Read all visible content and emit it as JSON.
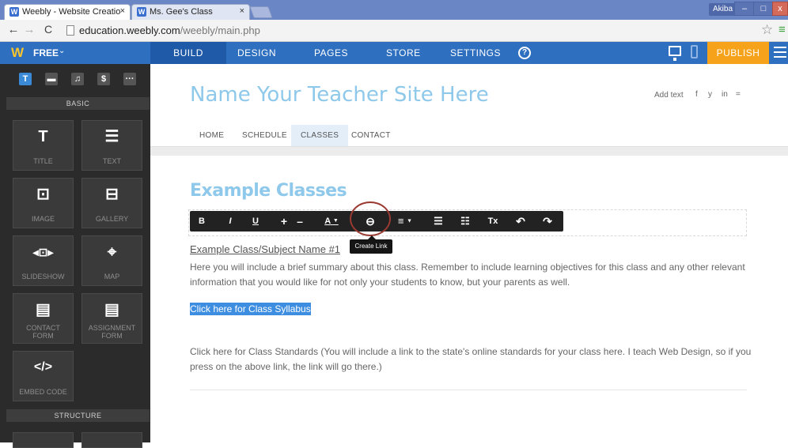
{
  "browser": {
    "tabs": [
      {
        "label": "Weebly - Website Creatio",
        "favicon": "weebly-icon"
      },
      {
        "label": "Ms. Gee's Class",
        "favicon": "weebly-icon"
      }
    ],
    "tab_close_glyph": "×",
    "user": "Akiba",
    "window_controls": {
      "minimize": "–",
      "maximize": "□",
      "close": "x"
    },
    "url_host": "education.weebly.com",
    "url_path": "/weebly/main.php"
  },
  "weebly": {
    "logo": "W",
    "plan": "FREE",
    "nav": {
      "build": "BUILD",
      "design": "DESIGN",
      "pages": "PAGES",
      "store": "STORE",
      "settings": "SETTINGS"
    },
    "help": "?",
    "publish": "PUBLISH",
    "accent": "#2f6fc0",
    "publish_color": "#f6a21b"
  },
  "sidebar": {
    "tools": [
      "T",
      "▬",
      "♫",
      "$",
      "···"
    ],
    "section_basic": "BASIC",
    "section_structure": "STRUCTURE",
    "tiles": [
      {
        "icon": "T",
        "label": "TITLE",
        "icon_name": "title-icon"
      },
      {
        "icon": "☰",
        "label": "TEXT",
        "icon_name": "text-icon"
      },
      {
        "icon": "⊡",
        "label": "IMAGE",
        "icon_name": "image-icon"
      },
      {
        "icon": "⊟",
        "label": "GALLERY",
        "icon_name": "gallery-icon"
      },
      {
        "icon": "◂⊡▸",
        "label": "SLIDESHOW",
        "icon_name": "slideshow-icon"
      },
      {
        "icon": "⌖",
        "label": "MAP",
        "icon_name": "map-icon"
      },
      {
        "icon": "▤",
        "label": "CONTACT FORM",
        "icon_name": "contact-form-icon"
      },
      {
        "icon": "▤",
        "label": "ASSIGNMENT FORM",
        "icon_name": "assignment-form-icon"
      },
      {
        "icon": "</>",
        "label": "EMBED CODE",
        "icon_name": "embed-code-icon"
      }
    ]
  },
  "site": {
    "title": "Name Your Teacher Site Here",
    "add_text": "Add text",
    "social": [
      "f",
      "y",
      "in",
      "="
    ],
    "nav": [
      "HOME",
      "SCHEDULE",
      "CLASSES",
      "CONTACT"
    ],
    "active_nav": "CLASSES"
  },
  "content": {
    "section_title": "Example Classes",
    "toolbar": [
      "B",
      "I",
      "U",
      "+",
      "–",
      "A",
      "⊖",
      "≡",
      "☰",
      "☷",
      "Tx",
      "↶",
      "↷"
    ],
    "tooltip": "Create Link",
    "sub_heading": "Example Class/Subject Name #1",
    "paragraph": "Here you will include a brief summary about this class. Remember to include learning objectives for this class and any other relevant information that you would like for not only your students to know, but your parents as well.",
    "syllabus_link": "Click here for Class Syllabus",
    "standards": "Click here for Class Standards (You will include a link to the state's online standards for your class here. I teach Web Design, so if you press on the above link, the link will go there.)"
  }
}
